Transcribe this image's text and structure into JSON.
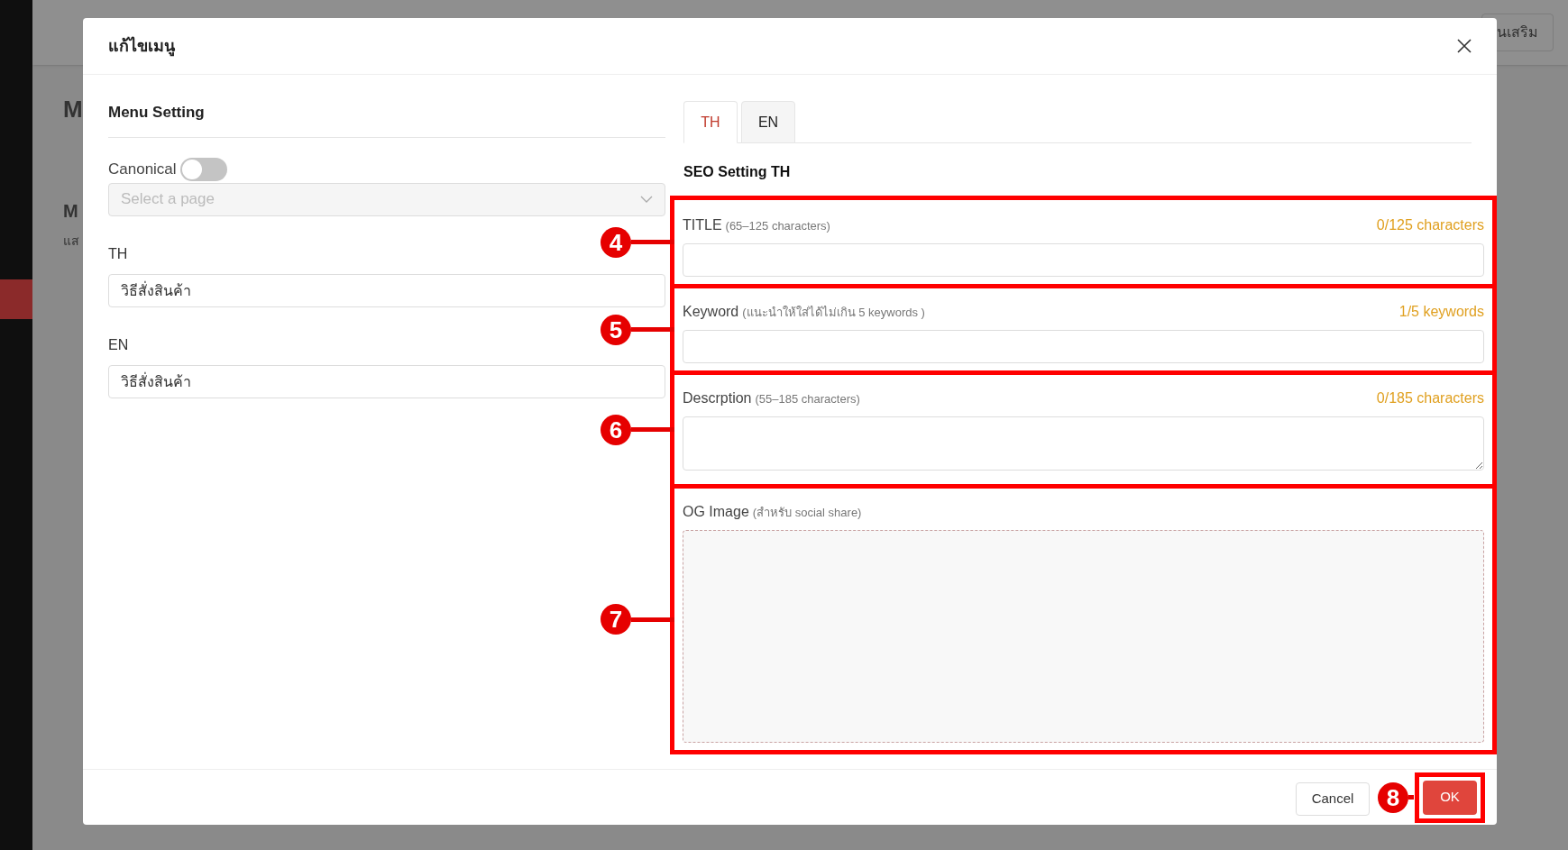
{
  "background": {
    "header_button": "นเสริม",
    "page_title": "M",
    "section_title": "M",
    "section_text": "แส"
  },
  "dialog": {
    "title": "แก้ไขเมนู",
    "menu_setting": {
      "heading": "Menu Setting",
      "canonical": {
        "label": "Canonical",
        "on": false
      },
      "page_select": {
        "placeholder": "Select a page"
      },
      "fields": [
        {
          "label": "TH",
          "value": "วิธีสั่งสินค้า"
        },
        {
          "label": "EN",
          "value": "วิธีสั่งสินค้า"
        }
      ]
    },
    "tabs": [
      {
        "label": "TH",
        "selected": true
      },
      {
        "label": "EN",
        "selected": false
      }
    ],
    "seo": {
      "heading": "SEO Setting TH",
      "fields": [
        {
          "kind": "input",
          "label": "TITLE",
          "hint": "(65–125 characters)",
          "counter": "0/125 characters",
          "callout": "4"
        },
        {
          "kind": "input",
          "label": "Keyword",
          "hint": "(แนะนำให้ใส่ได้ไม่เกิน 5 keywords )",
          "counter": "1/5 keywords",
          "callout": "5"
        },
        {
          "kind": "textarea",
          "label": "Descrption",
          "hint": "(55–185 characters)",
          "counter": "0/185 characters",
          "callout": "6"
        },
        {
          "kind": "upload",
          "label": "OG Image",
          "hint": "(สำหรับ social share)",
          "callout": "7"
        }
      ]
    },
    "buttons": [
      {
        "kind": "secondary",
        "label": "Cancel"
      },
      {
        "kind": "primary",
        "label": "OK",
        "callout": "8"
      }
    ]
  }
}
